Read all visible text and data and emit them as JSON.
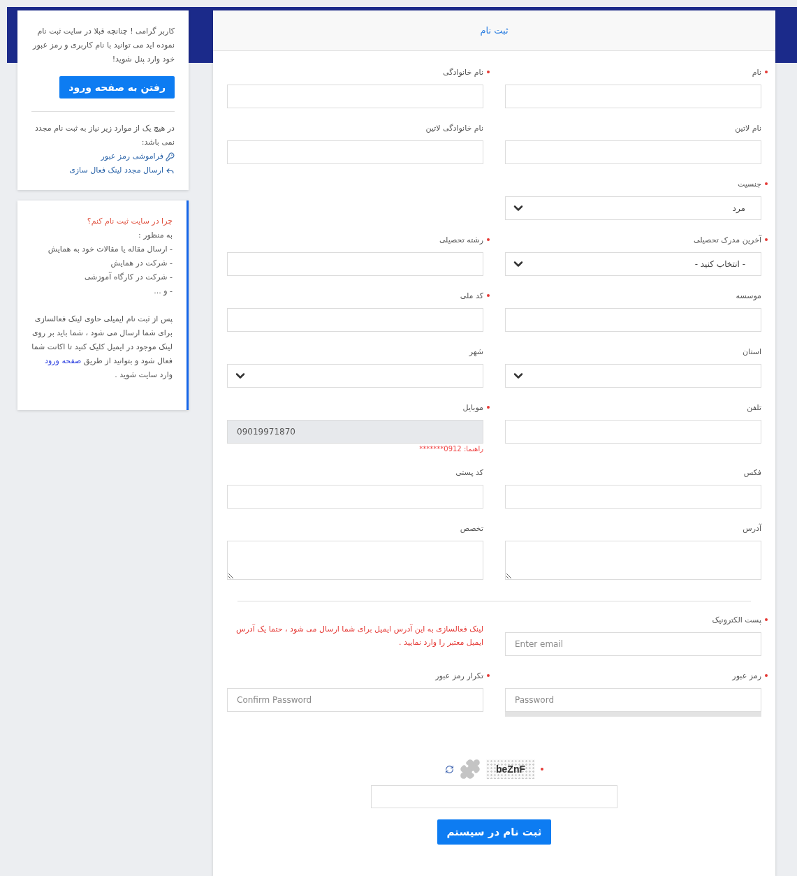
{
  "sidebar": {
    "login_card": {
      "message": "کاربر گرامی ! چنانچه قبلا در سایت ثبت نام نموده اید می توانید با نام کاربری و رمز عبور خود وارد پنل شوید!",
      "button": "رفتن به صفحه ورود",
      "note": "در هیچ یک از موارد زیر نیاز به ثبت نام مجدد نمی باشد:",
      "links": [
        {
          "kind": "key",
          "label": "فراموشی رمز عبور"
        },
        {
          "kind": "reply",
          "label": "ارسال مجدد لینک فعال سازی"
        }
      ]
    },
    "info_card": {
      "title": "چرا در سایت ثبت نام کنم؟",
      "lines": [
        "به منظور :",
        "- ارسال مقاله یا مقالات خود به همایش",
        "- شرکت در همایش",
        "- شرکت در کارگاه آموزشی",
        "- و ..."
      ],
      "paragraph_before": "پس از ثبت نام ایمیلی حاوی لینک فعالسازی برای شما ارسال می شود ، شما باید بر روی لینک موجود در ایمیل کلیک کنید تا اکانت شما فعال شود و بتوانید از طریق",
      "link": "صفحه ورود",
      "paragraph_after": "وارد سایت شوید ."
    }
  },
  "form": {
    "title": "ثبت نام",
    "rows": [
      {
        "right": {
          "kind": "text",
          "label": "نام",
          "required": true
        },
        "left": {
          "kind": "text",
          "label": "نام خانوادگی",
          "required": true
        }
      },
      {
        "right": {
          "kind": "text",
          "label": "نام لاتین",
          "required": false
        },
        "left": {
          "kind": "text",
          "label": "نام خانوادگی لاتین",
          "required": false
        }
      },
      {
        "right": {
          "kind": "select",
          "label": "جنسیت",
          "required": true,
          "value": "مرد"
        }
      },
      {
        "right": {
          "kind": "select",
          "label": "آخرین مدرک تحصیلی",
          "required": true,
          "value": "- انتخاب کنید -"
        },
        "left": {
          "kind": "text",
          "label": "رشته تحصیلی",
          "required": true
        }
      },
      {
        "right": {
          "kind": "text",
          "label": "موسسه",
          "required": false
        },
        "left": {
          "kind": "text",
          "label": "کد ملی",
          "required": true
        }
      },
      {
        "right": {
          "kind": "select",
          "label": "استان",
          "required": false
        },
        "left": {
          "kind": "select",
          "label": "شهر",
          "required": false
        }
      },
      {
        "right": {
          "kind": "text",
          "label": "تلفن",
          "required": false
        },
        "left": {
          "kind": "text",
          "label": "موبایل",
          "required": true,
          "value": "09019971870",
          "disabled": true,
          "hint": "راهنما: 0912*******"
        }
      },
      {
        "right": {
          "kind": "text",
          "label": "فکس",
          "required": false
        },
        "left": {
          "kind": "text",
          "label": "کد پستی",
          "required": false
        }
      },
      {
        "right": {
          "kind": "textarea",
          "label": "آدرس",
          "required": false
        },
        "left": {
          "kind": "textarea",
          "label": "تخصص",
          "required": false
        }
      }
    ],
    "account_rows": [
      {
        "right": {
          "kind": "text",
          "label": "پست الکترونیک",
          "required": true,
          "placeholder": "Enter email"
        },
        "left": {
          "kind": "note",
          "text": "لینک فعالسازی به این آدرس ایمیل برای شما ارسال می شود ، حتما یک آدرس ایمیل معتبر را وارد نمایید ."
        }
      },
      {
        "right": {
          "kind": "text",
          "label": "رمز عبور",
          "required": true,
          "placeholder": "Password",
          "meter": {
            "level": 0
          }
        },
        "left": {
          "kind": "text",
          "label": "تکرار رمز عبور",
          "required": true,
          "placeholder": "Confirm Password"
        }
      }
    ],
    "captcha": {
      "code": "beZnF",
      "required": true
    },
    "submit": "ثبت نام در سیستم"
  }
}
